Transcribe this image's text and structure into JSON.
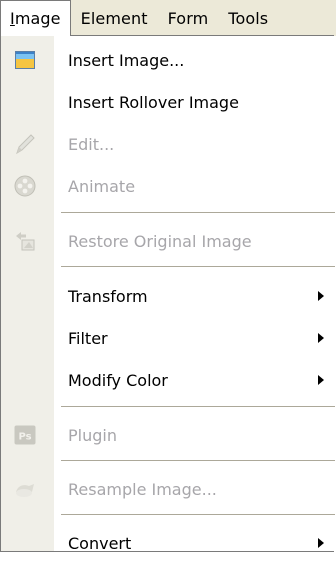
{
  "menubar": {
    "items": [
      {
        "mnemonic": "I",
        "rest": "mage"
      },
      {
        "label": "Element"
      },
      {
        "label": "Form"
      },
      {
        "label": "Tools"
      }
    ]
  },
  "dropdown": {
    "items": [
      {
        "label": "Insert Image...",
        "enabled": true,
        "icon": "insert-image-icon"
      },
      {
        "label": "Insert Rollover Image",
        "enabled": true
      },
      {
        "label": "Edit...",
        "enabled": false,
        "icon": "pencil-icon"
      },
      {
        "label": "Animate",
        "enabled": false,
        "icon": "film-reel-icon"
      },
      {
        "label": "Restore Original Image",
        "enabled": false,
        "icon": "restore-image-icon"
      },
      {
        "label": "Transform",
        "enabled": true,
        "submenu": true
      },
      {
        "label": "Filter",
        "enabled": true,
        "submenu": true
      },
      {
        "label": "Modify Color",
        "enabled": true,
        "submenu": true
      },
      {
        "label": "Plugin",
        "enabled": false,
        "icon": "photoshop-plugin-icon",
        "icon_text": "Ps"
      },
      {
        "label": "Resample Image...",
        "enabled": false,
        "icon": "resample-icon"
      },
      {
        "label": "Convert",
        "enabled": true,
        "submenu": true
      }
    ]
  },
  "colors": {
    "menubar_bg": "#ece9d8",
    "gutter_bg": "#f0efe8",
    "disabled_text": "#a7a6aa",
    "separator": "#aca899"
  }
}
